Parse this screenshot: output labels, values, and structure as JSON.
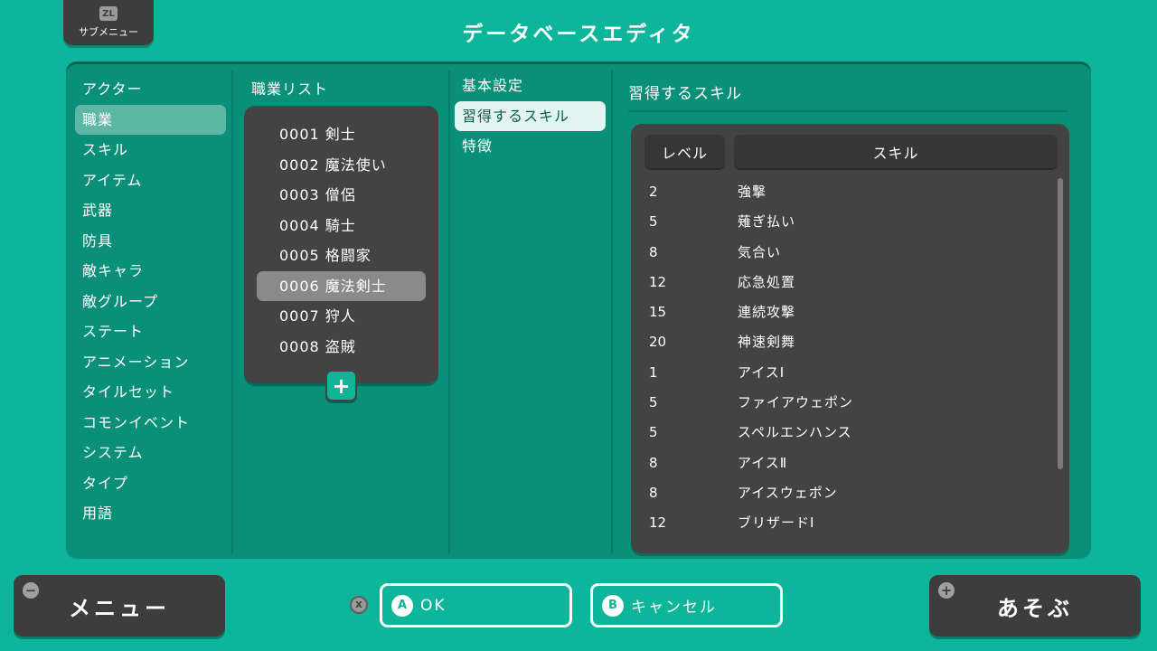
{
  "header": {
    "zl_badge": "ZL",
    "submenu_label": "サブメニュー",
    "title": "データベースエディタ"
  },
  "categories": [
    {
      "label": "アクター"
    },
    {
      "label": "職業"
    },
    {
      "label": "スキル"
    },
    {
      "label": "アイテム"
    },
    {
      "label": "武器"
    },
    {
      "label": "防具"
    },
    {
      "label": "敵キャラ"
    },
    {
      "label": "敵グループ"
    },
    {
      "label": "ステート"
    },
    {
      "label": "アニメーション"
    },
    {
      "label": "タイルセット"
    },
    {
      "label": "コモンイベント"
    },
    {
      "label": "システム"
    },
    {
      "label": "タイプ"
    },
    {
      "label": "用語"
    }
  ],
  "selected_category": "職業",
  "class_list": {
    "header": "職業リスト",
    "items": [
      {
        "label": "0001 剣士"
      },
      {
        "label": "0002 魔法使い"
      },
      {
        "label": "0003 僧侶"
      },
      {
        "label": "0004 騎士"
      },
      {
        "label": "0005 格闘家"
      },
      {
        "label": "0006 魔法剣士"
      },
      {
        "label": "0007 狩人"
      },
      {
        "label": "0008 盗賊"
      }
    ],
    "selected": "0006 魔法剣士",
    "add_icon": "plus-icon"
  },
  "tabs": [
    {
      "label": "基本設定"
    },
    {
      "label": "習得するスキル"
    },
    {
      "label": "特徴"
    }
  ],
  "selected_tab": "習得するスキル",
  "skills_section": {
    "title": "習得するスキル",
    "col_level": "レベル",
    "col_skill": "スキル",
    "rows": [
      {
        "level": "2",
        "skill": "強撃"
      },
      {
        "level": "5",
        "skill": "薙ぎ払い"
      },
      {
        "level": "8",
        "skill": "気合い"
      },
      {
        "level": "12",
        "skill": "応急処置"
      },
      {
        "level": "15",
        "skill": "連続攻撃"
      },
      {
        "level": "20",
        "skill": "神速剣舞"
      },
      {
        "level": "1",
        "skill": "アイスⅠ"
      },
      {
        "level": "5",
        "skill": "ファイアウェポン"
      },
      {
        "level": "5",
        "skill": "スペルエンハンス"
      },
      {
        "level": "8",
        "skill": "アイスⅡ"
      },
      {
        "level": "8",
        "skill": "アイスウェポン"
      },
      {
        "level": "12",
        "skill": "ブリザードⅠ"
      }
    ]
  },
  "footer": {
    "menu_label": "メニュー",
    "menu_icon": "minus-icon",
    "x_badge": "X",
    "ok_badge": "A",
    "ok_label": "OK",
    "cancel_badge": "B",
    "cancel_label": "キャンセル",
    "play_label": "あそぶ",
    "play_icon": "plus-icon"
  },
  "colors": {
    "background": "#0db69a",
    "panel": "#0a8f79",
    "list_box": "#434343",
    "selected_category": "#5eb6a5",
    "selected_class": "#8a8a8a",
    "selected_tab": "#e2f4f1"
  }
}
